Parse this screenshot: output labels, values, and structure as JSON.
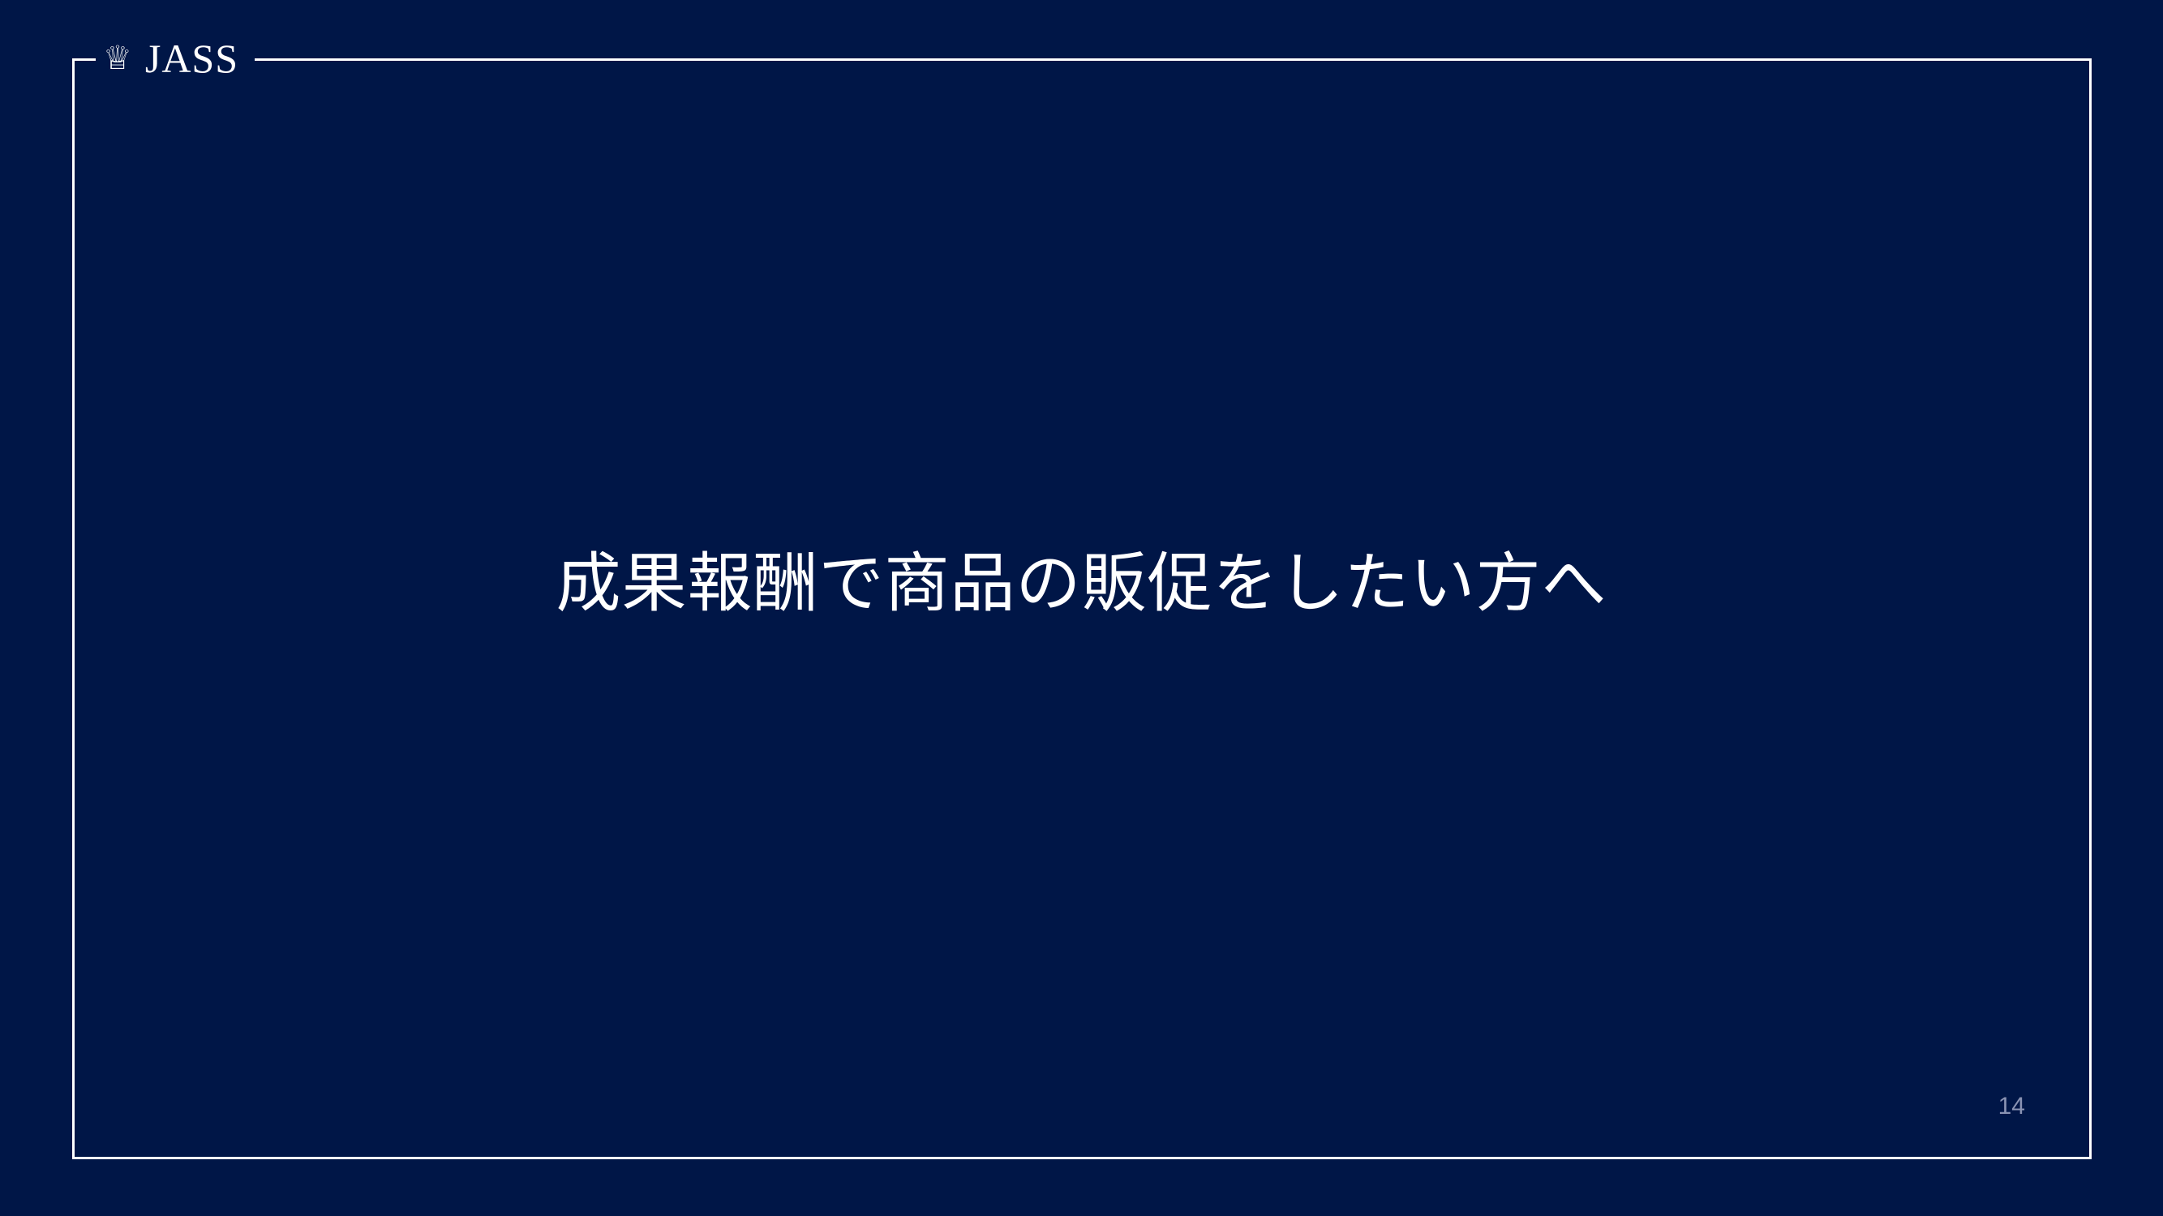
{
  "brand": {
    "icon": "crown-icon",
    "icon_glyph": "♕",
    "name": "JASS"
  },
  "slide": {
    "title": "成果報酬で商品の販促をしたい方へ",
    "page_number": "14"
  },
  "colors": {
    "background": "#001647",
    "frame": "#ffffff",
    "text": "#ffffff",
    "page_number": "#8a93b3"
  }
}
